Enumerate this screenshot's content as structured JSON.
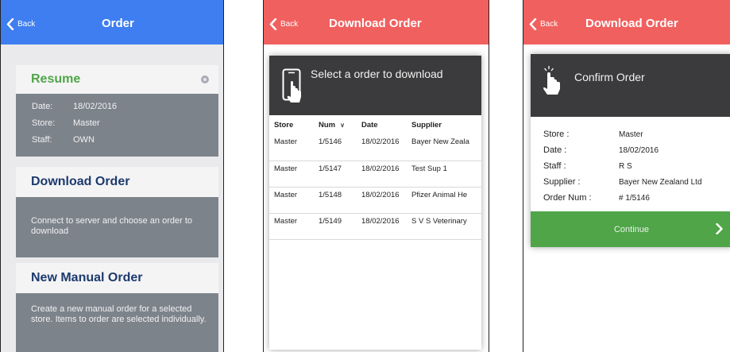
{
  "screen1": {
    "nav": {
      "back_label": "Back",
      "title": "Order"
    },
    "resume": {
      "title": "Resume",
      "rows": [
        {
          "label": "Date:",
          "value": "18/02/2016"
        },
        {
          "label": "Store:",
          "value": "Master"
        },
        {
          "label": "Staff:",
          "value": "OWN"
        }
      ]
    },
    "download": {
      "title": "Download Order",
      "description": "Connect to server and choose an order to download"
    },
    "manual": {
      "title": "New Manual Order",
      "description": "Create a new manual order for a selected store. Items to order are selected individually."
    }
  },
  "screen2": {
    "nav": {
      "back_label": "Back",
      "title": "Download Order"
    },
    "prompt": "Select a order to download",
    "columns": [
      "Store",
      "Num",
      "Date",
      "Supplier"
    ],
    "rows": [
      [
        "Master",
        "1/5146",
        "18/02/2016",
        "Bayer New Zeala"
      ],
      [
        "Master",
        "1/5147",
        "18/02/2016",
        "Test Sup 1"
      ],
      [
        "Master",
        "1/5148",
        "18/02/2016",
        "Pfizer Animal He"
      ],
      [
        "Master",
        "1/5149",
        "18/02/2016",
        "S V S Veterinary"
      ]
    ]
  },
  "screen3": {
    "nav": {
      "back_label": "Back",
      "title": "Download Order"
    },
    "title": "Confirm Order",
    "rows": [
      {
        "label": "Store :",
        "value": "Master"
      },
      {
        "label": "Date :",
        "value": "18/02/2016"
      },
      {
        "label": "Staff :",
        "value": "R S"
      },
      {
        "label": "Supplier :",
        "value": "Bayer New Zealand Ltd"
      },
      {
        "label": "Order Num :",
        "value": "# 1/5146"
      }
    ],
    "continue_label": "Continue"
  },
  "colors": {
    "blue_nav": "#3e7ef0",
    "red_nav": "#f0605f",
    "green": "#4fa548",
    "dark_header": "#3b3b3d",
    "card_body": "#7d838b",
    "title_navy": "#1d3a6e"
  },
  "icons": [
    "chevron-left-icon",
    "close-circle-icon",
    "tablet-touch-icon",
    "hand-tap-icon",
    "chevron-down-icon",
    "chevron-right-icon"
  ]
}
